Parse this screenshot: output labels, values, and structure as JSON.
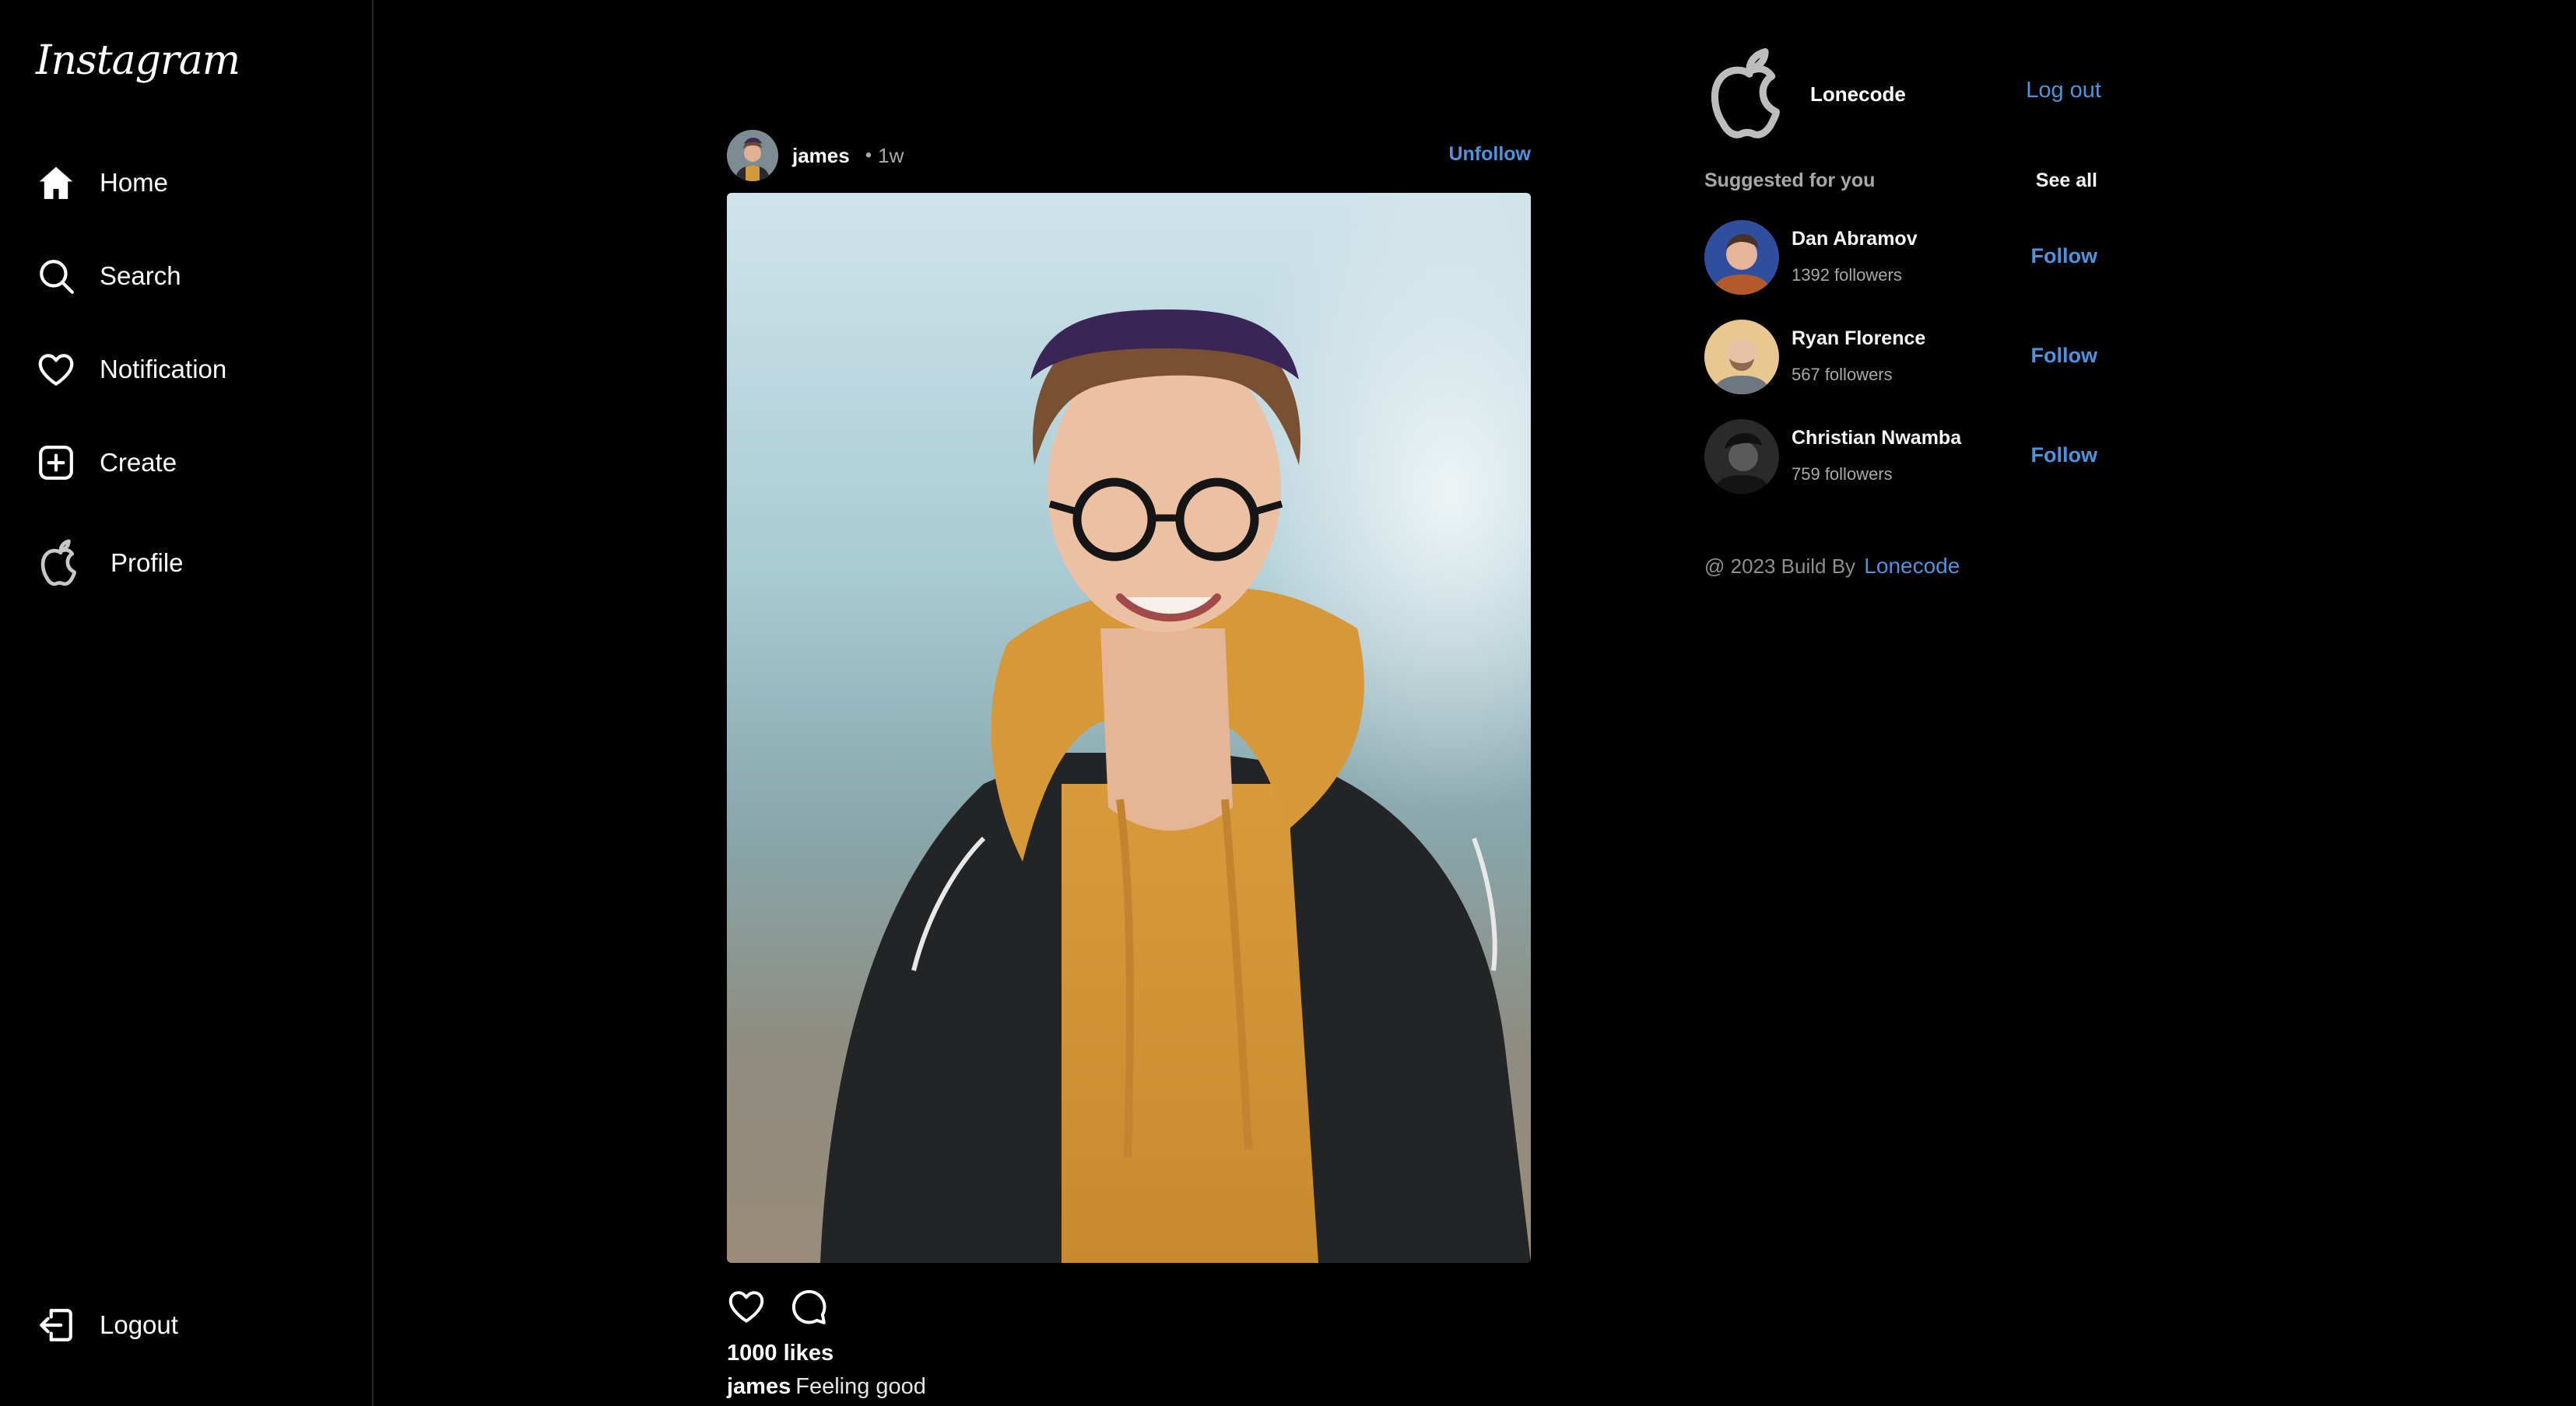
{
  "app": {
    "logo_text": "Instagram"
  },
  "sidebar": {
    "items": [
      {
        "label": "Home",
        "icon": "home-icon"
      },
      {
        "label": "Search",
        "icon": "search-icon"
      },
      {
        "label": "Notification",
        "icon": "heart-icon"
      },
      {
        "label": "Create",
        "icon": "plus-square-icon"
      },
      {
        "label": "Profile",
        "icon": "apple-logo-icon"
      }
    ],
    "logout_label": "Logout",
    "logout_icon": "logout-icon"
  },
  "post": {
    "username": "james",
    "separator": "•",
    "time_ago": "1w",
    "unfollow_label": "Unfollow",
    "like_icon": "heart-outline-icon",
    "comment_icon": "comment-icon",
    "likes_text": "1000 likes",
    "caption_user": "james",
    "caption_text": "Feeling good"
  },
  "right_panel": {
    "current_user": "Lonecode",
    "logout_label": "Log out",
    "suggestions_title": "Suggested for you",
    "see_all_label": "See all",
    "suggestions": [
      {
        "name": "Dan Abramov",
        "followers": "1392 followers",
        "follow_label": "Follow"
      },
      {
        "name": "Ryan Florence",
        "followers": "567 followers",
        "follow_label": "Follow"
      },
      {
        "name": "Christian Nwamba",
        "followers": "759 followers",
        "follow_label": "Follow"
      }
    ],
    "footer_prefix": "@ 2023 Build By",
    "footer_link": "Lonecode"
  },
  "colors": {
    "background": "#000000",
    "accent": "#4d93e0",
    "muted_text": "#a8a8a8",
    "divider": "#262626"
  }
}
